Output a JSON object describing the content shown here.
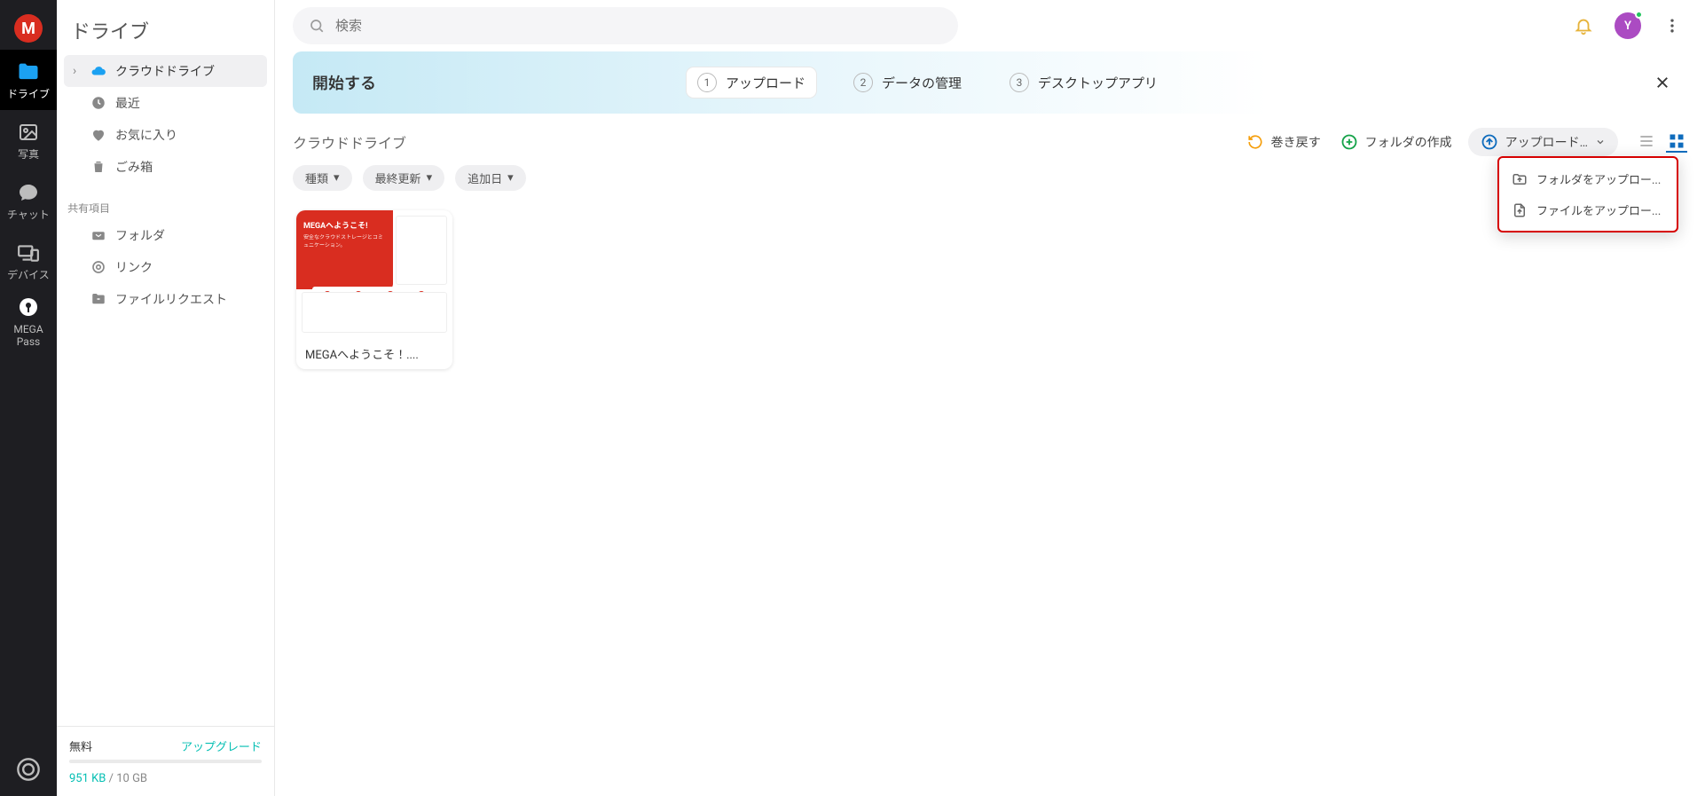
{
  "rail": {
    "drive": "ドライブ",
    "photos": "写真",
    "chat": "チャット",
    "devices": "デバイス",
    "pass1": "MEGA",
    "pass2": "Pass"
  },
  "tree": {
    "header": "ドライブ",
    "cloud_drive": "クラウドドライブ",
    "recent": "最近",
    "favorites": "お気に入り",
    "trash": "ごみ箱",
    "shared_section": "共有項目",
    "shared_folder": "フォルダ",
    "shared_link": "リンク",
    "file_request": "ファイルリクエスト",
    "plan": "無料",
    "upgrade": "アップグレード",
    "storage_used": "951 KB",
    "storage_sep": " / ",
    "storage_total": "10 GB"
  },
  "search": {
    "placeholder": "検索"
  },
  "avatar_initial": "Y",
  "onboard": {
    "title": "開始する",
    "step1": "アップロード",
    "step2": "データの管理",
    "step3": "デスクトップアプリ"
  },
  "breadcrumb": "クラウドドライブ",
  "actions": {
    "rewind": "巻き戻す",
    "new_folder": "フォルダの作成",
    "upload": "アップロード…"
  },
  "chips": {
    "type": "種類",
    "modified": "最終更新",
    "added": "追加日"
  },
  "card": {
    "thumb_title": "MEGAへようこそ!",
    "thumb_sub": "安全なクラウドストレージとコミュニケーション。",
    "caption": "MEGAへようこそ！...."
  },
  "dropdown": {
    "upload_folder": "フォルダをアップロー...",
    "upload_file": "ファイルをアップロー..."
  }
}
